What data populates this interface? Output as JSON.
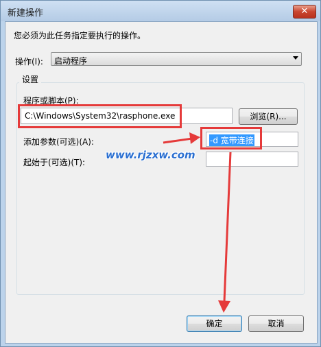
{
  "window": {
    "title": "新建操作",
    "close_icon": "close-icon"
  },
  "intro": "您必须为此任务指定要执行的操作。",
  "action": {
    "label": "操作(I):",
    "value": "启动程序"
  },
  "settings": {
    "group_label": "设置",
    "program_label": "程序或脚本(P):",
    "program_value": "C:\\Windows\\System32\\rasphone.exe",
    "browse_label": "浏览(R)...",
    "args_label": "添加参数(可选)(A):",
    "args_value": "-d 宽带连接",
    "start_label": "起始于(可选)(T):",
    "start_value": ""
  },
  "watermark": "www.rjzxw.com",
  "buttons": {
    "ok": "确定",
    "cancel": "取消"
  },
  "colors": {
    "annotation_red": "#e53a3a",
    "selection": "#3399ff",
    "watermark": "#2a6fd1"
  }
}
